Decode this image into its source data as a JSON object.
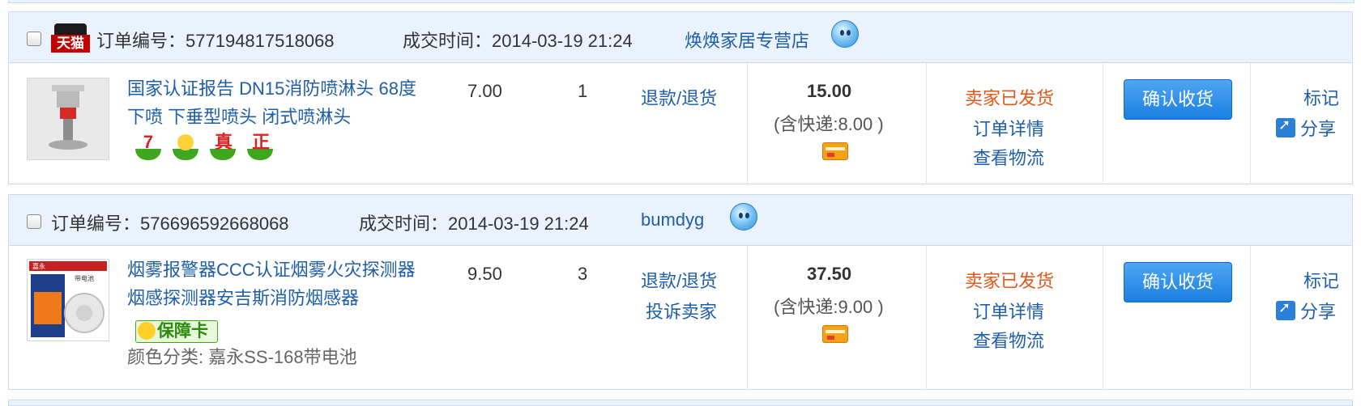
{
  "orders": [
    {
      "tmall_label": "天猫",
      "order_no_label": "订单编号：",
      "order_no": "577194817518068",
      "time_label": "成交时间：",
      "time": "2014-03-19 21:24",
      "shop": "焕焕家居专营店",
      "item": {
        "title": "国家认证报告 DN15消防喷淋头 68度下喷 下垂型喷头 闭式喷淋头",
        "unit_price": "7.00",
        "qty": "1",
        "actions": [
          "退款/退货"
        ],
        "badges": [
          "7",
          "",
          "真",
          "正"
        ]
      },
      "total": "15.00",
      "shipping": "(含快递:8.00 )",
      "status": "卖家已发货",
      "links": [
        "订单详情",
        "查看物流"
      ],
      "confirm_button": "确认收货",
      "mark": "标记",
      "share": "分享"
    },
    {
      "order_no_label": "订单编号：",
      "order_no": "576696592668068",
      "time_label": "成交时间：",
      "time": "2014-03-19 21:24",
      "shop": "bumdyg",
      "item": {
        "title": "烟雾报警器CCC认证烟雾火灾探测器烟感探测器安吉斯消防烟感器",
        "unit_price": "9.50",
        "qty": "3",
        "actions": [
          "退款/退货",
          "投诉卖家"
        ],
        "guarantee": "保障卡",
        "spec": "颜色分类: 嘉永SS-168带电池",
        "thumb_brand": "嘉永",
        "thumb_text": "带电池"
      },
      "total": "37.50",
      "shipping": "(含快递:9.00 )",
      "status": "卖家已发货",
      "links": [
        "订单详情",
        "查看物流"
      ],
      "confirm_button": "确认收货",
      "mark": "标记",
      "share": "分享"
    }
  ]
}
